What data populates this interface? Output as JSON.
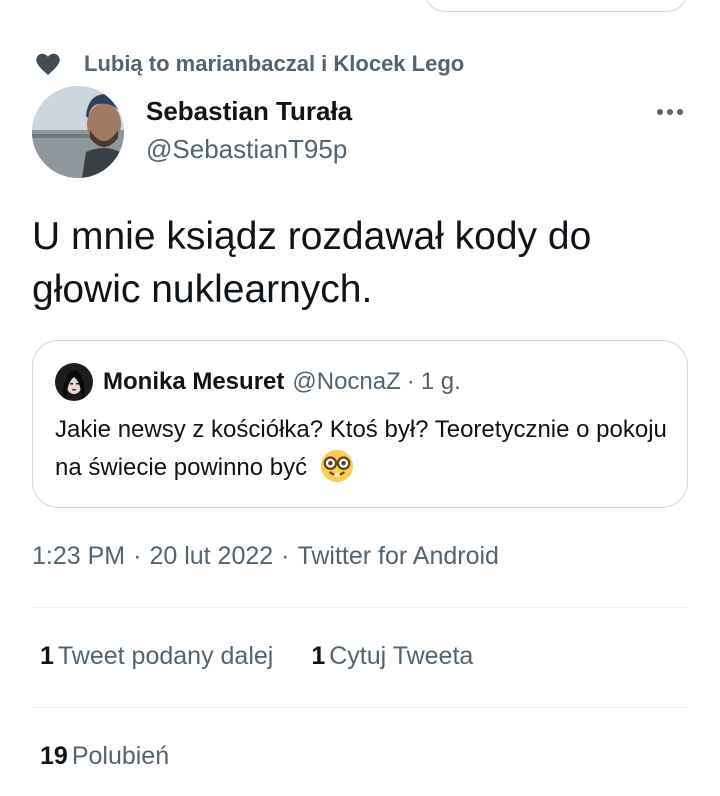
{
  "social_context": {
    "text": "Lubią to marianbaczal i Klocek Lego",
    "icon": "heart-icon"
  },
  "author": {
    "name": "Sebastian Turała",
    "handle": "@SebastianT95p"
  },
  "tweet": {
    "text": "U mnie ksiądz rozdawał kody do głowic nuklearnych."
  },
  "quoted_tweet": {
    "name": "Monika Mesuret",
    "handle": "@NocnaZ",
    "separator": "·",
    "time": "1 g.",
    "text": "Jakie newsy z kościółka? Ktoś był? Teoretycznie o pokoju na świecie powinno być",
    "emoji": "nerd-face-emoji"
  },
  "meta": {
    "time": "1:23 PM",
    "date": "20 lut 2022",
    "source": "Twitter for Android",
    "separator": "·"
  },
  "stats": {
    "retweets": {
      "count": "1",
      "label": "Tweet podany dalej"
    },
    "quotes": {
      "count": "1",
      "label": "Cytuj Tweeta"
    },
    "likes": {
      "count": "19",
      "label": "Polubień"
    }
  },
  "colors": {
    "text_primary": "#0f1419",
    "text_secondary": "#536471",
    "border": "#cfd9de",
    "divider": "#eff3f4"
  }
}
